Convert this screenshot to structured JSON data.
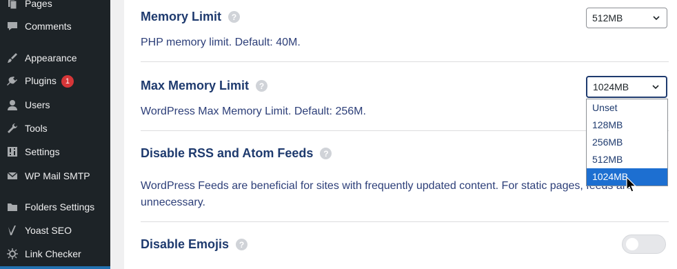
{
  "sidebar": {
    "items": [
      {
        "label": "Pages",
        "icon": "pages-icon"
      },
      {
        "label": "Comments",
        "icon": "comments-icon"
      },
      {
        "label": "Appearance",
        "icon": "appearance-icon"
      },
      {
        "label": "Plugins",
        "icon": "plugins-icon",
        "badge": "1"
      },
      {
        "label": "Users",
        "icon": "users-icon"
      },
      {
        "label": "Tools",
        "icon": "tools-icon"
      },
      {
        "label": "Settings",
        "icon": "settings-icon"
      },
      {
        "label": "WP Mail SMTP",
        "icon": "mail-icon"
      },
      {
        "label": "Folders Settings",
        "icon": "folder-icon"
      },
      {
        "label": "Yoast SEO",
        "icon": "yoast-icon"
      },
      {
        "label": "Link Checker",
        "icon": "link-checker-icon"
      }
    ]
  },
  "options": {
    "memory_limit": {
      "title": "Memory Limit",
      "description": "PHP memory limit. Default: 40M.",
      "selected": "512MB"
    },
    "max_memory_limit": {
      "title": "Max Memory Limit",
      "description": "WordPress Max Memory Limit. Default: 256M.",
      "selected": "1024MB",
      "options": [
        "Unset",
        "128MB",
        "256MB",
        "512MB",
        "1024MB"
      ]
    },
    "disable_feeds": {
      "title": "Disable RSS and Atom Feeds",
      "description": "WordPress Feeds are beneficial for sites with frequently updated content. For static pages, feeds are unnecessary."
    },
    "disable_emojis": {
      "title": "Disable Emojis",
      "enabled": false
    }
  },
  "help_glyph": "?",
  "colors": {
    "sidebar_bg": "#1d2327",
    "title": "#1e3a6e",
    "highlight": "#1d6fd1",
    "badge": "#d63638"
  }
}
